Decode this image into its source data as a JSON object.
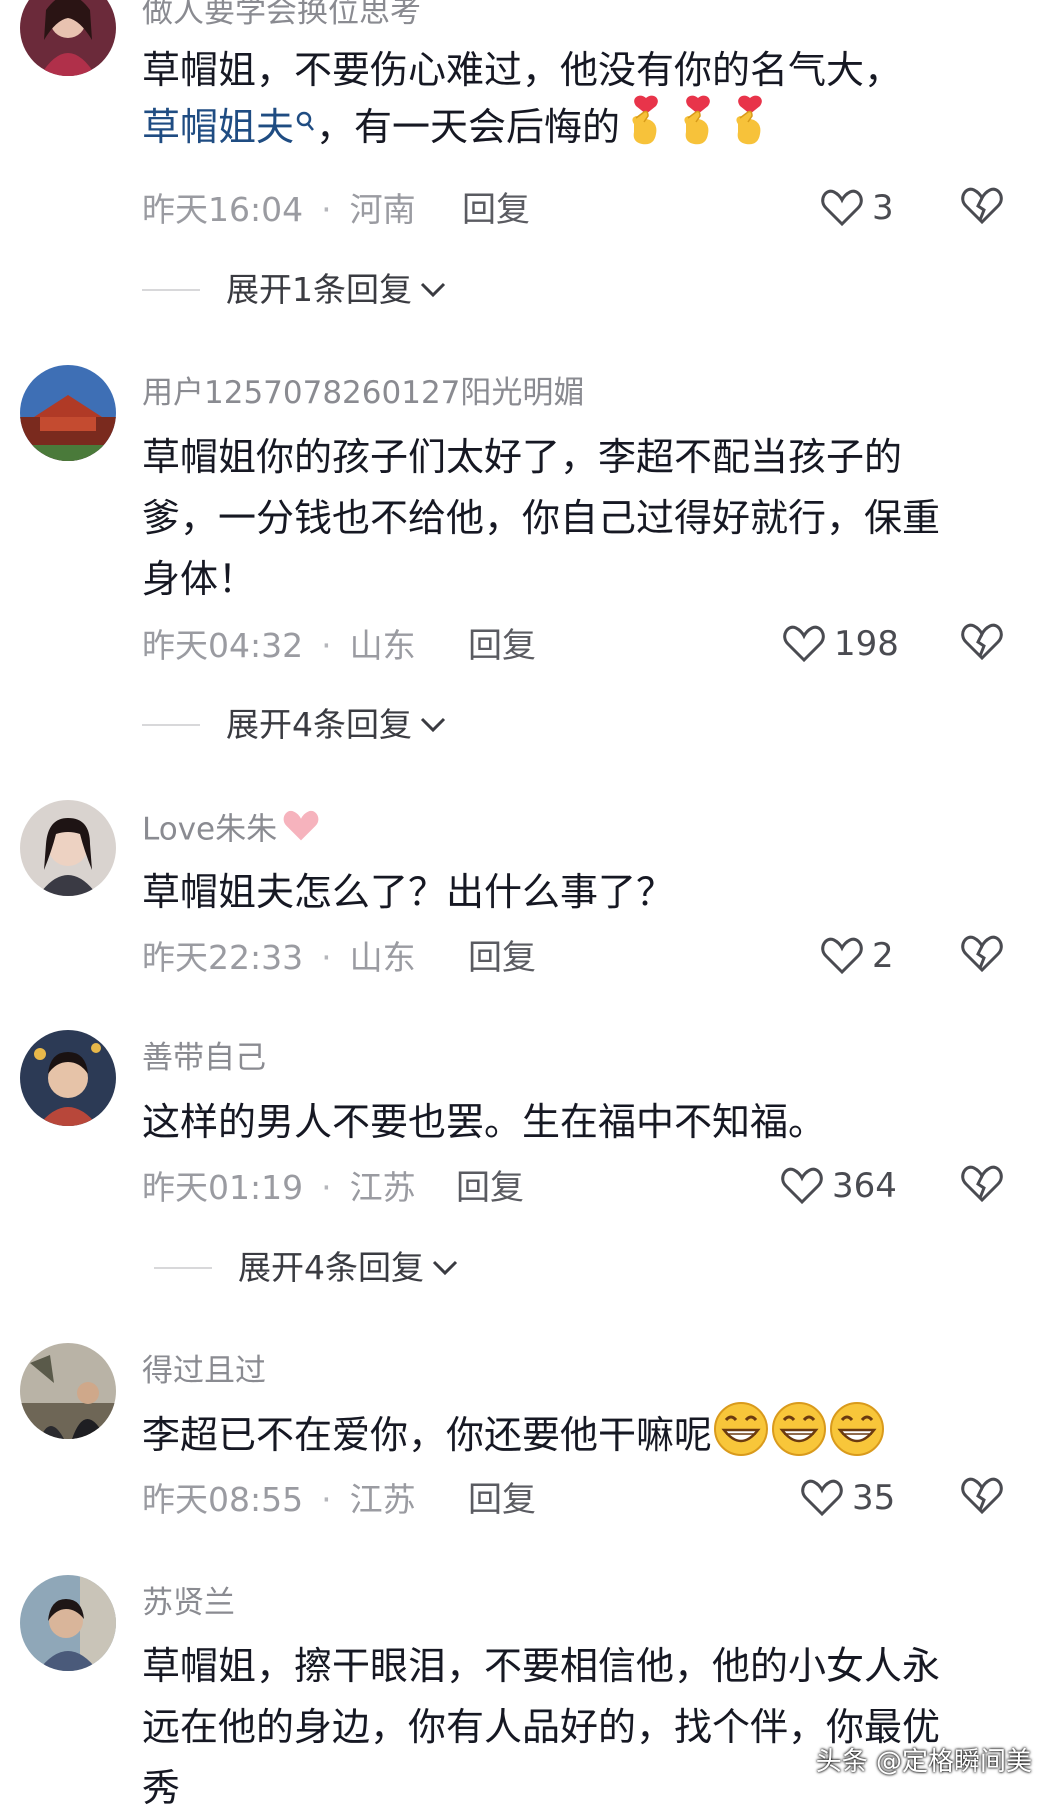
{
  "comments": [
    {
      "username": "做人要学会换位思考",
      "text_lines": [
        "草帽姐，不要伤心难过，他没有你的名气大，"
      ],
      "link_text": "草帽姐夫",
      "link_tail": "，有一天会后悔的",
      "emojis": [
        "finger-heart-emoji",
        "finger-heart-emoji",
        "finger-heart-emoji"
      ],
      "time": "昨天16:04",
      "location": "河南",
      "reply": "回复",
      "likes": "3",
      "expand": "展开1条回复"
    },
    {
      "username": "用户1257078260127阳光明媚",
      "text_lines": [
        "草帽姐你的孩子们太好了，李超不配当孩子的",
        "爹，一分钱也不给他，你自己过得好就行，保重",
        "身体！"
      ],
      "time": "昨天04:32",
      "location": "山东",
      "reply": "回复",
      "likes": "198",
      "expand": "展开4条回复"
    },
    {
      "username": "Love朱朱",
      "text_lines": [
        "草帽姐夫怎么了？出什么事了？"
      ],
      "time": "昨天22:33",
      "location": "山东",
      "reply": "回复",
      "likes": "2"
    },
    {
      "username": "善带自己",
      "text_lines": [
        "这样的男人不要也罢。生在福中不知福。"
      ],
      "time": "昨天01:19",
      "location": "江苏",
      "reply": "回复",
      "likes": "364",
      "expand": "展开4条回复"
    },
    {
      "username": "得过且过",
      "text_lines": [
        "李超已不在爱你，你还要他干嘛呢"
      ],
      "emojis": [
        "grin-emoji",
        "grin-emoji",
        "grin-emoji"
      ],
      "time": "昨天08:55",
      "location": "江苏",
      "reply": "回复",
      "likes": "35"
    },
    {
      "username": "苏贤兰",
      "text_lines": [
        "草帽姐，擦干眼泪，不要相信他，他的小女人永",
        "远在他的身边，你有人品好的，找个伴，你最优",
        "秀"
      ]
    }
  ],
  "watermark": "头条 @定格瞬间美",
  "colors": {
    "link": "#1f4c82",
    "meta": "#9a9ba1",
    "text": "#161823"
  }
}
